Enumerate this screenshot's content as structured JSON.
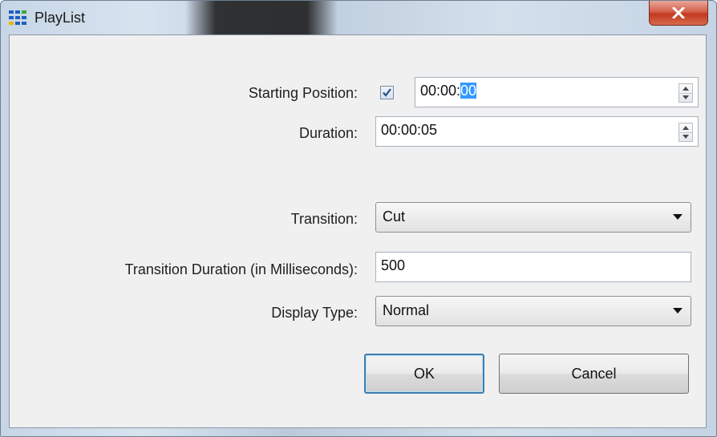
{
  "window": {
    "title": "PlayList",
    "close_glyph": "X",
    "icon": "grid-app-icon",
    "close_color": "#c23a1f"
  },
  "form": {
    "starting_position": {
      "label": "Starting Position:",
      "checked": true,
      "value_prefix": "00:00:",
      "value_selected": "00"
    },
    "duration": {
      "label": "Duration:",
      "value": "00:00:05"
    },
    "transition": {
      "label": "Transition:",
      "selected": "Cut"
    },
    "transition_duration": {
      "label": "Transition Duration (in Milliseconds):",
      "value": "500"
    },
    "display_type": {
      "label": "Display Type:",
      "selected": "Normal"
    }
  },
  "buttons": {
    "ok": "OK",
    "cancel": "Cancel"
  },
  "colors": {
    "selection": "#3399ff",
    "default_button_border": "#3c7fb1"
  }
}
